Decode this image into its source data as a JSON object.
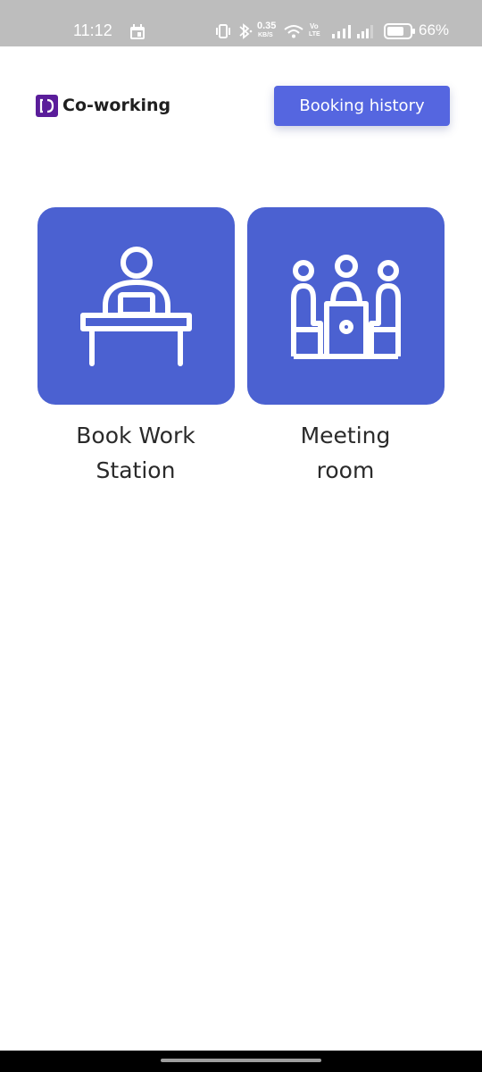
{
  "status_bar": {
    "time": "11:12",
    "network_speed_value": "0.35",
    "network_speed_unit": "KB/S",
    "volte_top": "Vo",
    "volte_bottom": "LTE",
    "battery_percent": "66%",
    "icons": [
      "calendar-icon",
      "vibrate-icon",
      "bluetooth-icon",
      "wifi-icon",
      "signal-icon",
      "signal-icon",
      "battery-icon"
    ]
  },
  "header": {
    "logo_letter": "D",
    "app_title": "Co-working",
    "history_button_label": "Booking history"
  },
  "options": [
    {
      "label": "Book Work\nStation",
      "icon": "desk-person-icon"
    },
    {
      "label": "Meeting\nroom",
      "icon": "meeting-room-icon"
    }
  ],
  "colors": {
    "card": "#4b61d1",
    "button": "#5566e0",
    "logo": "#5a1d9a",
    "status_bar": "#bdbdbd"
  }
}
